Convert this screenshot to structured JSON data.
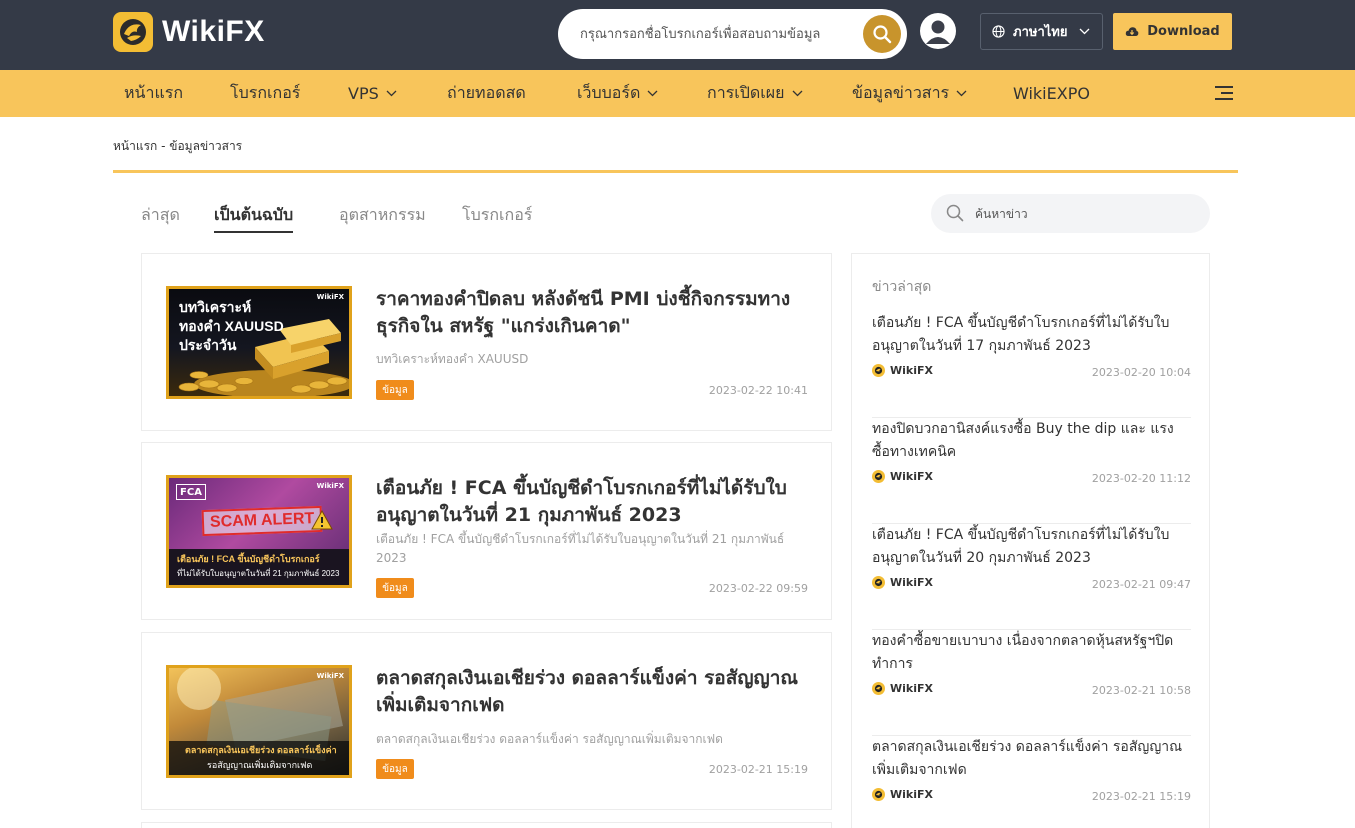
{
  "header": {
    "logo_text": "WikiFX",
    "search_placeholder": "กรุณากรอกชื่อโบรกเกอร์เพื่อสอบถามข้อมูล",
    "language_label": "ภาษาไทย",
    "download_label": "Download",
    "colors": {
      "topbar": "#343a47",
      "accent": "#f8c55b",
      "search_button": "#c8942c"
    }
  },
  "nav": {
    "items": [
      {
        "label": "หน้าแรก",
        "has_dropdown": false
      },
      {
        "label": "โบรกเกอร์",
        "has_dropdown": false
      },
      {
        "label": "VPS",
        "has_dropdown": true
      },
      {
        "label": "ถ่ายทอดสด",
        "has_dropdown": false
      },
      {
        "label": "เว็บบอร์ด",
        "has_dropdown": true
      },
      {
        "label": "การเปิดเผย",
        "has_dropdown": true
      },
      {
        "label": "ข้อมูลข่าวสาร",
        "has_dropdown": true
      },
      {
        "label": "WikiEXPO",
        "has_dropdown": false
      }
    ],
    "menu_icon": "hamburger-icon"
  },
  "breadcrumb": {
    "home": "หน้าแรก",
    "separator": " - ",
    "current": "ข้อมูลข่าวสาร"
  },
  "tabs": [
    {
      "label": "ล่าสุด",
      "active": false
    },
    {
      "label": "เป็นต้นฉบับ",
      "active": true
    },
    {
      "label": "อุตสาหกรรม",
      "active": false
    },
    {
      "label": "โบรกเกอร์",
      "active": false
    }
  ],
  "news_search": {
    "placeholder": "ค้นหาข่าว"
  },
  "articles": [
    {
      "title": "ราคาทองคำปิดลบ หลังดัชนี PMI บ่งชี้กิจกรรมทางธุรกิจใน สหรัฐ \"แกร่งเกินคาด\"",
      "subtitle": "บทวิเคราะห์ทองคำ XAUUSD",
      "tag": "ข้อมูล",
      "date": "2023-02-22 10:41",
      "thumb": {
        "line1": "บทวิเคราะห์",
        "line2": "ทองคำ XAUUSD",
        "line3": "ประจำวัน",
        "brand": "WikiFX"
      }
    },
    {
      "title": "เตือนภัย ! FCA ขึ้นบัญชีดำโบรกเกอร์ที่ไม่ได้รับใบอนุญาตในวันที่ 21 กุมภาพันธ์ 2023",
      "subtitle": "เตือนภัย ! FCA ขึ้นบัญชีดำโบรกเกอร์ที่ไม่ได้รับใบอนุญาตในวันที่ 21 กุมภาพันธ์ 2023",
      "tag": "ข้อมูล",
      "date": "2023-02-22 09:59",
      "thumb": {
        "badge": "FCA",
        "alert": "SCAM ALERT",
        "line1": "เตือนภัย ! FCA ขึ้นบัญชีดำโบรกเกอร์",
        "line2": "ที่ไม่ได้รับใบอนุญาตในวันที่ 21 กุมภาพันธ์ 2023",
        "brand": "WikiFX"
      }
    },
    {
      "title": "ตลาดสกุลเงินเอเชียร่วง ดอลลาร์แข็งค่า รอสัญญาณเพิ่มเติมจากเฟด",
      "subtitle": "ตลาดสกุลเงินเอเชียร่วง ดอลลาร์แข็งค่า รอสัญญาณเพิ่มเติมจากเฟด",
      "tag": "ข้อมูล",
      "date": "2023-02-21 15:19",
      "thumb": {
        "line1": "ตลาดสกุลเงินเอเชียร่วง ดอลลาร์แข็งค่า",
        "line2": "รอสัญญาณเพิ่มเติมจากเฟด",
        "brand": "WikiFX"
      }
    }
  ],
  "sidebar": {
    "title": "ข่าวล่าสุด",
    "items": [
      {
        "title": "เตือนภัย ! FCA ขึ้นบัญชีดำโบรกเกอร์ที่ไม่ได้รับใบอนุญาตในวันที่ 17 กุมภาพันธ์ 2023",
        "source": "WikiFX",
        "date": "2023-02-20 10:04"
      },
      {
        "title": "ทองปิดบวกอานิสงค์แรงซื้อ Buy the dip และ แรงซื้อทางเทคนิค",
        "source": "WikiFX",
        "date": "2023-02-20 11:12"
      },
      {
        "title": "เตือนภัย ! FCA ขึ้นบัญชีดำโบรกเกอร์ที่ไม่ได้รับใบอนุญาตในวันที่ 20 กุมภาพันธ์ 2023",
        "source": "WikiFX",
        "date": "2023-02-21 09:47"
      },
      {
        "title": "ทองคำซื้อขายเบาบาง เนื่องจากตลาดหุ้นสหรัฐฯปิดทำการ",
        "source": "WikiFX",
        "date": "2023-02-21 10:58"
      },
      {
        "title": "ตลาดสกุลเงินเอเชียร่วง ดอลลาร์แข็งค่า รอสัญญาณเพิ่มเติมจากเฟด",
        "source": "WikiFX",
        "date": "2023-02-21 15:19"
      }
    ]
  }
}
